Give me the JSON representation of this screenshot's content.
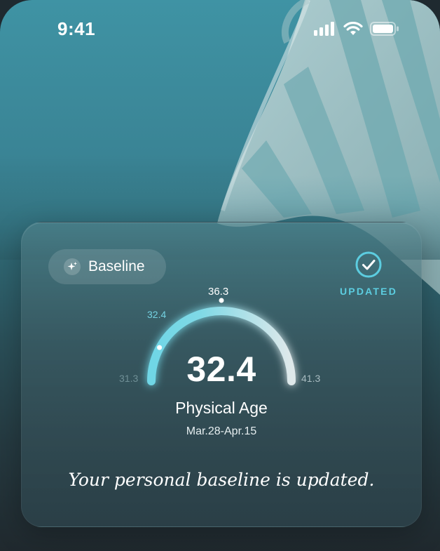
{
  "status_bar": {
    "time": "9:41",
    "icons": [
      "cellular-signal-icon",
      "wifi-icon",
      "battery-icon"
    ]
  },
  "card": {
    "badge_label": "Baseline",
    "badge_icon": "sparkle-icon",
    "updated_label": "UPDATED",
    "updated_icon": "check-circle-icon",
    "gauge": {
      "min_label": "31.3",
      "max_label": "41.3",
      "top_label": "36.3",
      "marker_label": "32.4",
      "min": 31.3,
      "max": 41.3,
      "value": 32.4
    },
    "value": "32.4",
    "metric": "Physical Age",
    "date_range": "Mar.28-Apr.15",
    "message": "Your personal baseline is updated."
  },
  "colors": {
    "accent": "#5ccde0",
    "arc_start": "#6fd6e6",
    "arc_end": "#dfe8ea"
  }
}
